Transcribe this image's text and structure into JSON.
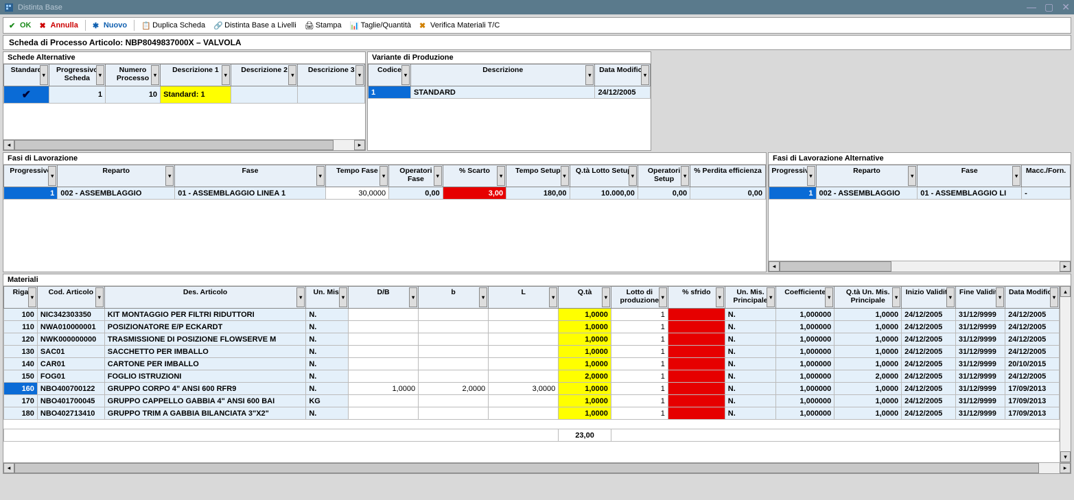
{
  "window": {
    "title": "Distinta Base"
  },
  "toolbar": {
    "ok": "OK",
    "annulla": "Annulla",
    "nuovo": "Nuovo",
    "duplica": "Duplica Scheda",
    "livelli": "Distinta Base a Livelli",
    "stampa": "Stampa",
    "taglie": "Taglie/Quantità",
    "verifica": "Verifica Materiali T/C"
  },
  "subtitle": "Scheda di Processo Articolo: NBP8049837000X – VALVOLA",
  "schede": {
    "title": "Schede Alternative",
    "headers": [
      "Standard",
      "Progressivo Scheda",
      "Numero Processo",
      "Descrizione 1",
      "Descrizione 2",
      "Descrizione 3"
    ],
    "row": {
      "prog": "1",
      "num": "10",
      "desc1": "Standard: 1"
    }
  },
  "variante": {
    "title": "Variante di Produzione",
    "headers": [
      "Codice",
      "Descrizione",
      "Data Modifica"
    ],
    "row": {
      "codice": "1",
      "desc": "STANDARD",
      "data": "24/12/2005"
    }
  },
  "fasi": {
    "title": "Fasi di Lavorazione",
    "headers": [
      "Progressivo",
      "Reparto",
      "Fase",
      "Tempo Fase",
      "Operatori Fase",
      "% Scarto",
      "Tempo Setup",
      "Q.tà Lotto Setup",
      "Operatori Setup",
      "% Perdita efficienza"
    ],
    "row": {
      "prog": "1",
      "reparto": "002 - ASSEMBLAGGIO",
      "fase": "01  - ASSEMBLAGGIO LINEA 1",
      "tempo": "30,0000",
      "operatori": "0,00",
      "scarto": "3,00",
      "tsetup": "180,00",
      "qlotto": "10.000,00",
      "opsetup": "0,00",
      "perdita": "0,00"
    }
  },
  "fasialt": {
    "title": "Fasi di Lavorazione Alternative",
    "headers": [
      "Progressivo",
      "Reparto",
      "Fase",
      "Macc./Forn."
    ],
    "row": {
      "prog": "1",
      "reparto": "002 - ASSEMBLAGGIO",
      "fase": "01  - ASSEMBLAGGIO LI",
      "macc": "-"
    }
  },
  "materiali": {
    "title": "Materiali",
    "headers": [
      "Riga",
      "Cod. Articolo",
      "Des. Articolo",
      "Un. Mis.",
      "D/B",
      "b",
      "L",
      "Q.tà",
      "Lotto di produzione",
      "% sfrido",
      "Un. Mis. Principale",
      "Coefficiente",
      "Q.tà Un. Mis. Principale",
      "Inizio Validità",
      "Fine Validità",
      "Data Modifica"
    ],
    "rows": [
      {
        "riga": "100",
        "cod": "NIC342303350",
        "des": "KIT MONTAGGIO PER FILTRI RIDUTTORI",
        "um": "N.",
        "db": "",
        "b": "",
        "l": "",
        "qta": "1,0000",
        "lotto": "1",
        "sfrido": "",
        "ump": "N.",
        "coef": "1,000000",
        "qump": "1,0000",
        "inizio": "24/12/2005",
        "fine": "31/12/9999",
        "mod": "24/12/2005",
        "sel": false
      },
      {
        "riga": "110",
        "cod": "NWA010000001",
        "des": "POSIZIONATORE E/P ECKARDT",
        "um": "N.",
        "db": "",
        "b": "",
        "l": "",
        "qta": "1,0000",
        "lotto": "1",
        "sfrido": "",
        "ump": "N.",
        "coef": "1,000000",
        "qump": "1,0000",
        "inizio": "24/12/2005",
        "fine": "31/12/9999",
        "mod": "24/12/2005",
        "sel": false
      },
      {
        "riga": "120",
        "cod": "NWK000000000",
        "des": "TRASMISSIONE DI POSIZIONE FLOWSERVE M",
        "um": "N.",
        "db": "",
        "b": "",
        "l": "",
        "qta": "1,0000",
        "lotto": "1",
        "sfrido": "",
        "ump": "N.",
        "coef": "1,000000",
        "qump": "1,0000",
        "inizio": "24/12/2005",
        "fine": "31/12/9999",
        "mod": "24/12/2005",
        "sel": false
      },
      {
        "riga": "130",
        "cod": "SAC01",
        "des": "SACCHETTO PER IMBALLO",
        "um": "N.",
        "db": "",
        "b": "",
        "l": "",
        "qta": "1,0000",
        "lotto": "1",
        "sfrido": "",
        "ump": "N.",
        "coef": "1,000000",
        "qump": "1,0000",
        "inizio": "24/12/2005",
        "fine": "31/12/9999",
        "mod": "24/12/2005",
        "sel": false
      },
      {
        "riga": "140",
        "cod": "CAR01",
        "des": "CARTONE PER IMBALLO",
        "um": "N.",
        "db": "",
        "b": "",
        "l": "",
        "qta": "1,0000",
        "lotto": "1",
        "sfrido": "",
        "ump": "N.",
        "coef": "1,000000",
        "qump": "1,0000",
        "inizio": "24/12/2005",
        "fine": "31/12/9999",
        "mod": "20/10/2015",
        "sel": false
      },
      {
        "riga": "150",
        "cod": "FOG01",
        "des": "FOGLIO ISTRUZIONI",
        "um": "N.",
        "db": "",
        "b": "",
        "l": "",
        "qta": "2,0000",
        "lotto": "1",
        "sfrido": "",
        "ump": "N.",
        "coef": "1,000000",
        "qump": "2,0000",
        "inizio": "24/12/2005",
        "fine": "31/12/9999",
        "mod": "24/12/2005",
        "sel": false
      },
      {
        "riga": "160",
        "cod": "NBO400700122",
        "des": "GRUPPO CORPO 4\" ANSI 600 RFR9",
        "um": "N.",
        "db": "1,0000",
        "b": "2,0000",
        "l": "3,0000",
        "qta": "1,0000",
        "lotto": "1",
        "sfrido": "",
        "ump": "N.",
        "coef": "1,000000",
        "qump": "1,0000",
        "inizio": "24/12/2005",
        "fine": "31/12/9999",
        "mod": "17/09/2013",
        "sel": true
      },
      {
        "riga": "170",
        "cod": "NBO401700045",
        "des": "GRUPPO CAPPELLO GABBIA 4\" ANSI 600 BAI",
        "um": "KG",
        "db": "",
        "b": "",
        "l": "",
        "qta": "1,0000",
        "lotto": "1",
        "sfrido": "",
        "ump": "N.",
        "coef": "1,000000",
        "qump": "1,0000",
        "inizio": "24/12/2005",
        "fine": "31/12/9999",
        "mod": "17/09/2013",
        "sel": false
      },
      {
        "riga": "180",
        "cod": "NBO402713410",
        "des": "GRUPPO TRIM A GABBIA BILANCIATA 3\"X2\"",
        "um": "N.",
        "db": "",
        "b": "",
        "l": "",
        "qta": "1,0000",
        "lotto": "1",
        "sfrido": "",
        "ump": "N.",
        "coef": "1,000000",
        "qump": "1,0000",
        "inizio": "24/12/2005",
        "fine": "31/12/9999",
        "mod": "17/09/2013",
        "sel": false
      }
    ],
    "total_qta": "23,00"
  }
}
